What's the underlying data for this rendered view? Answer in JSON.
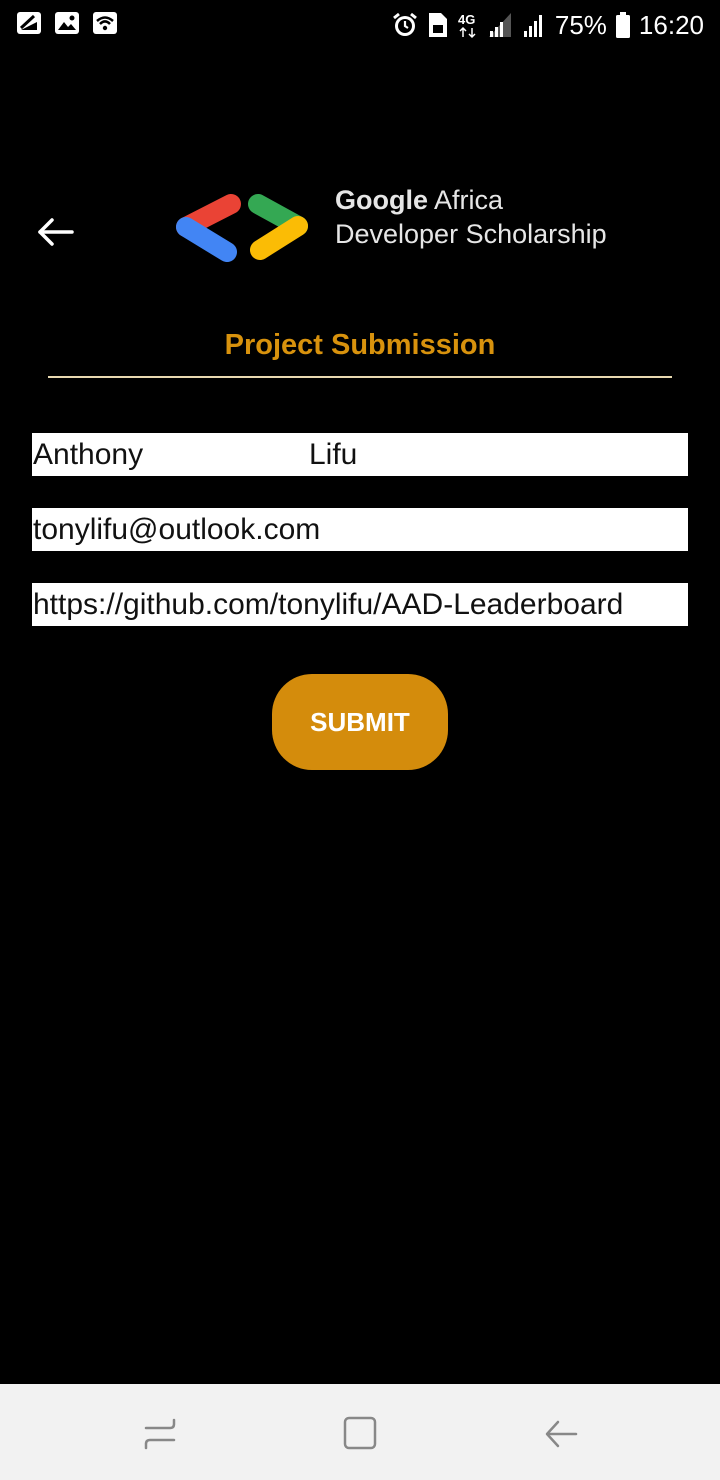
{
  "status_bar": {
    "left_icons": [
      "screenshot-icon",
      "gallery-icon",
      "wifi-icon"
    ],
    "right_icons": [
      "alarm-icon",
      "sim-icon",
      "network-4g-icon",
      "signal-icon",
      "signal-icon-2",
      "battery-icon"
    ],
    "battery_percent": "75%",
    "time": "16:20"
  },
  "header": {
    "back_icon": "arrow-left-icon",
    "logo_line1_bold": "Google",
    "logo_line1_rest": " Africa",
    "logo_line2": "Developer Scholarship",
    "logo_colors": {
      "red": "#ea4335",
      "blue": "#4285f4",
      "green": "#34a853",
      "yellow": "#fbbc05"
    }
  },
  "form": {
    "title": "Project Submission",
    "first_name": "Anthony",
    "last_name": "Lifu",
    "email": "tonylifu@outlook.com",
    "github_link": "https://github.com/tonylifu/AAD-Leaderboard",
    "submit_label": "SUBMIT"
  },
  "colors": {
    "accent": "#d8920d",
    "button": "#d48c0c",
    "background": "#000000",
    "nav_bar": "#f2f2f2"
  },
  "nav_bar": {
    "icons": [
      "recent-apps-icon",
      "home-icon",
      "back-icon"
    ]
  }
}
